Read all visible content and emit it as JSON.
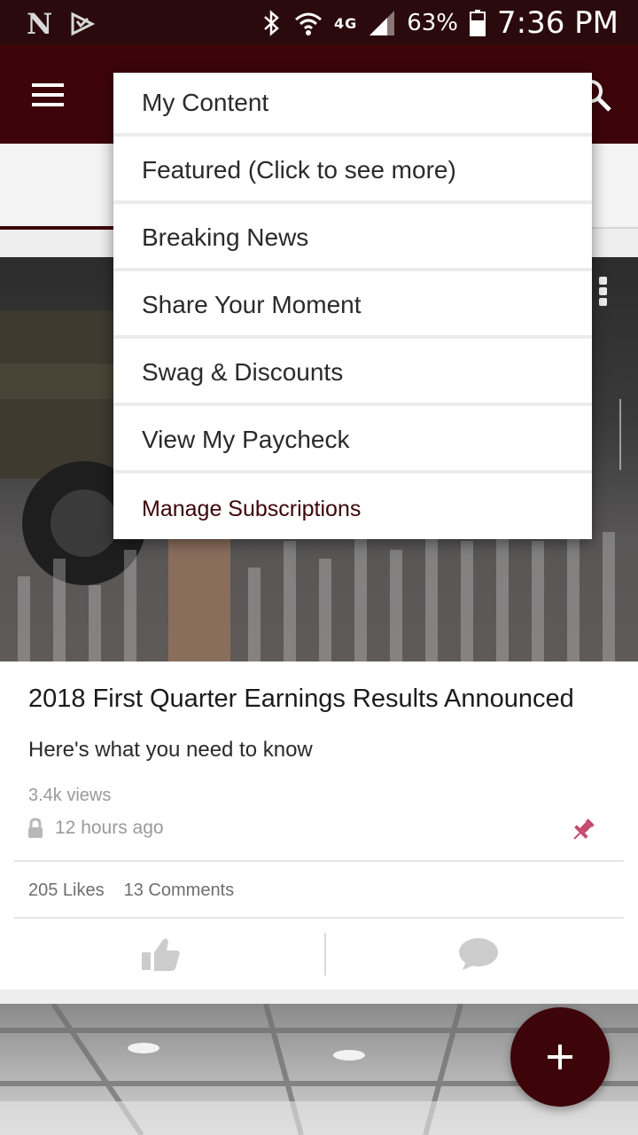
{
  "status_bar": {
    "network": "4G",
    "battery": "63%",
    "time": "7:36 PM"
  },
  "dropdown": {
    "items": [
      {
        "label": "My Content"
      },
      {
        "label": "Featured (Click to see more)"
      },
      {
        "label": "Breaking News"
      },
      {
        "label": "Share Your Moment"
      },
      {
        "label": "Swag & Discounts"
      },
      {
        "label": "View My Paycheck"
      },
      {
        "label": "Manage Subscriptions"
      }
    ]
  },
  "post": {
    "title": "2018 First Quarter Earnings Results Announced",
    "subtitle": "Here's what you need to know",
    "views": "3.4k views",
    "time": "12 hours ago",
    "likes": "205 Likes",
    "comments": "13 Comments"
  },
  "colors": {
    "brand": "#3d0509",
    "pin": "#c44a6e"
  },
  "icons": {
    "menu": "hamburger-icon",
    "search": "search-icon",
    "lock": "lock-icon",
    "pin": "pin-icon",
    "like": "thumbs-up-icon",
    "comment": "comment-bubble-icon",
    "add": "plus-icon"
  }
}
